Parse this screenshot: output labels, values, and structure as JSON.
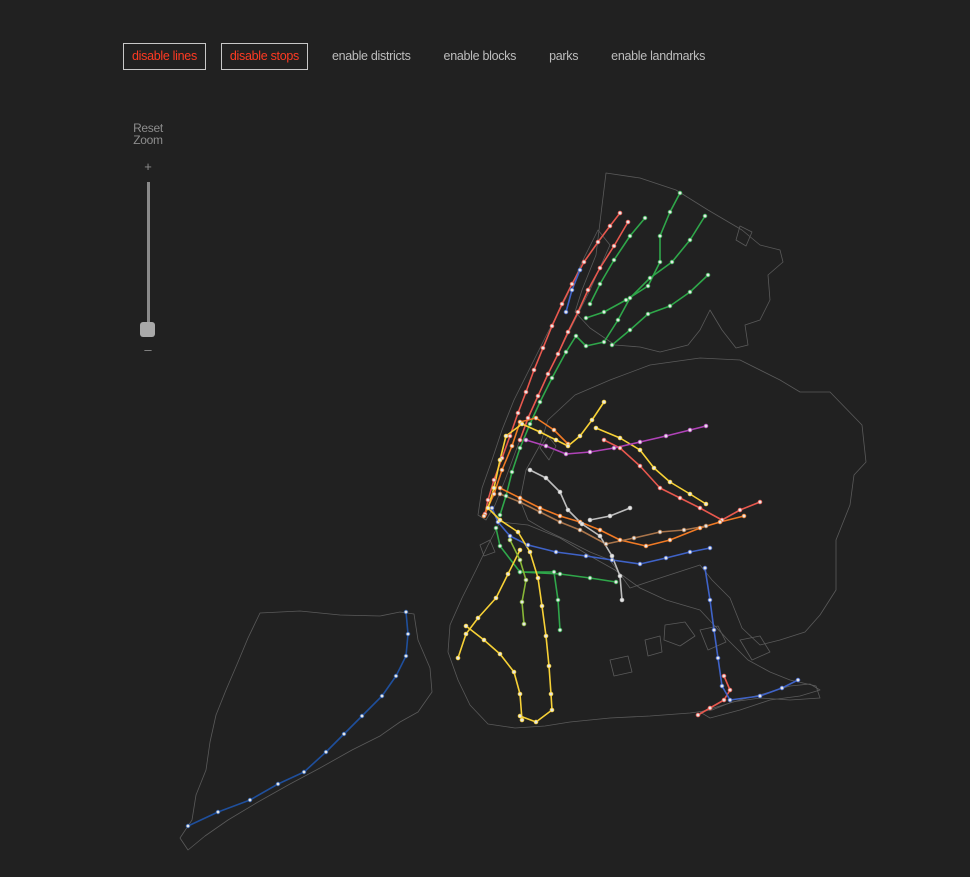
{
  "toolbar": {
    "disable_lines": "disable lines",
    "disable_stops": "disable stops",
    "enable_districts": "enable districts",
    "enable_blocks": "enable blocks",
    "parks": "parks",
    "enable_landmarks": "enable landmarks"
  },
  "zoom": {
    "reset_line1": "Reset",
    "reset_line2": "Zoom",
    "plus": "+",
    "minus": "–",
    "level": 0
  },
  "colors": {
    "background": "#212121",
    "borough_outline": "#5a5a5a",
    "active_text": "#ff3a22",
    "inactive_text": "#bdbdbd",
    "stop_fill": "#e6e6e6"
  },
  "lines": [
    {
      "name": "red",
      "color": "#e8584e"
    },
    {
      "name": "green",
      "color": "#2fa74a"
    },
    {
      "name": "blue",
      "color": "#3f63c8"
    },
    {
      "name": "orange",
      "color": "#f07a25"
    },
    {
      "name": "yellow",
      "color": "#f7d136"
    },
    {
      "name": "purple",
      "color": "#b043b8"
    },
    {
      "name": "brown",
      "color": "#a9744a"
    },
    {
      "name": "gray",
      "color": "#bdbdbd"
    },
    {
      "name": "lime",
      "color": "#87b636"
    },
    {
      "name": "navy",
      "color": "#1f4f9c"
    }
  ]
}
